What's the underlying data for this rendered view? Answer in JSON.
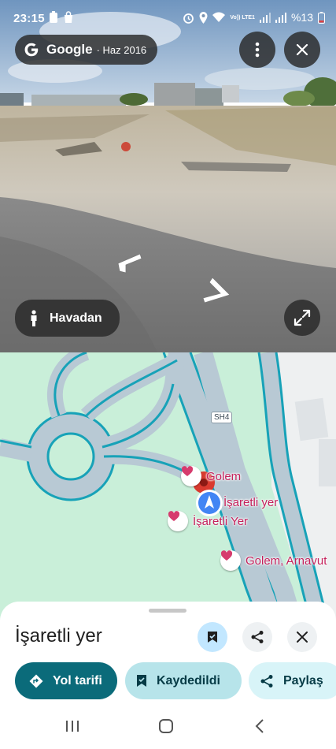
{
  "status_bar": {
    "time": "23:15",
    "network": "Vo)) LTE1",
    "battery": "%13"
  },
  "street_view": {
    "brand": "Google",
    "date": "· Haz 2016",
    "aerial_label": "Havadan",
    "icons": [
      "more-vert-icon",
      "close-icon",
      "pegman-icon",
      "expand-icon",
      "nav-arrow-icon"
    ]
  },
  "map": {
    "road_label": "SH4",
    "pois": [
      {
        "label": "Golem"
      },
      {
        "label": "İşaretli yer"
      },
      {
        "label": "İşaretli Yer"
      },
      {
        "label": "Golem, Arnavut"
      }
    ],
    "colors": {
      "green": "#c9efd9",
      "road": "#b8c9d4",
      "road_edge": "#17a2b8",
      "poi": "#c5205b"
    }
  },
  "sheet": {
    "title": "İşaretli yer",
    "buttons": {
      "directions": "Yol tarifi",
      "saved": "Kaydedildi",
      "share": "Paylaş"
    }
  },
  "colors": {
    "primary": "#0b6b7a",
    "saved_chip": "#b7e4ea",
    "share_chip": "#d8f4f8"
  }
}
